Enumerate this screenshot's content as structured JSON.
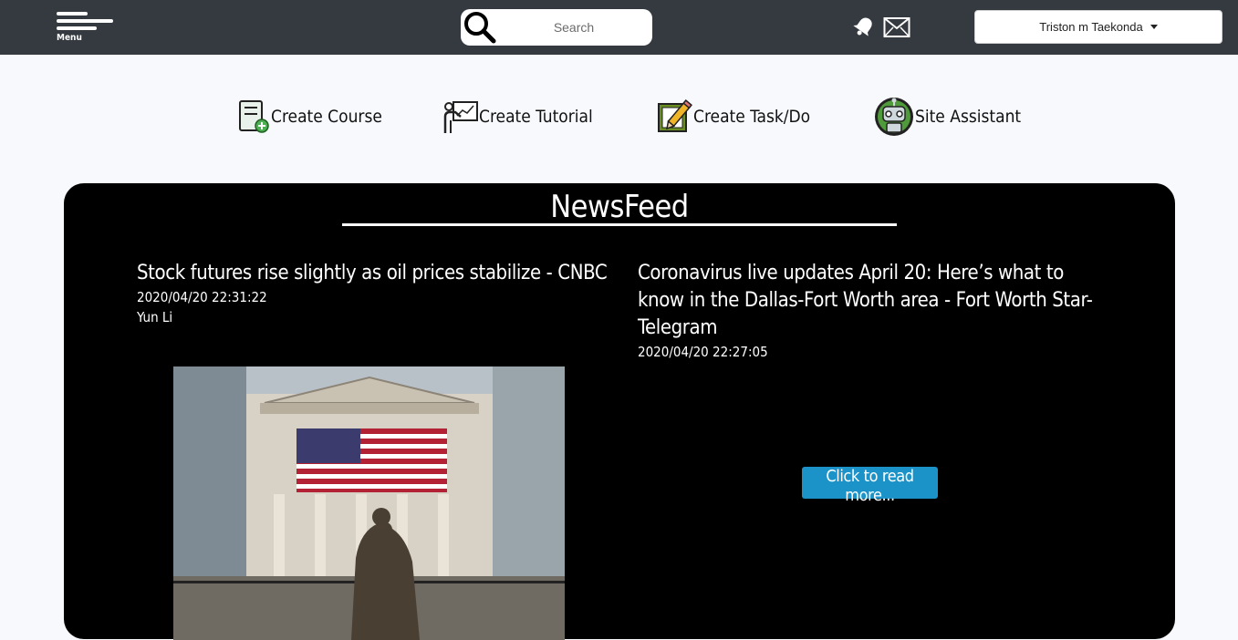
{
  "topbar": {
    "menu_label": "Menu",
    "search_placeholder": "Search",
    "user_name": "Triston m Taekonda",
    "background": "#343a40"
  },
  "actions": [
    {
      "label": "Create Course",
      "icon": "course-icon"
    },
    {
      "label": "Create Tutorial",
      "icon": "tutorial-icon"
    },
    {
      "label": "Create Task/Do",
      "icon": "task-icon"
    },
    {
      "label": "Site Assistant",
      "icon": "robot-icon"
    }
  ],
  "newsfeed": {
    "title": "NewsFeed",
    "articles": [
      {
        "headline": "Stock futures rise slightly as oil prices stabilize - CNBC",
        "date": "2020/04/20 22:31:22",
        "author": "Yun Li"
      },
      {
        "headline": "Coronavirus live updates April 20: Here’s what to know in the Dallas-Fort Worth area - Fort Worth Star-Telegram",
        "date": "2020/04/20 22:27:05",
        "read_more": "Click to read more..."
      }
    ]
  },
  "colors": {
    "accent": "#1b93c8",
    "feed_background": "#000000",
    "page_background": "#f8f9fc"
  }
}
